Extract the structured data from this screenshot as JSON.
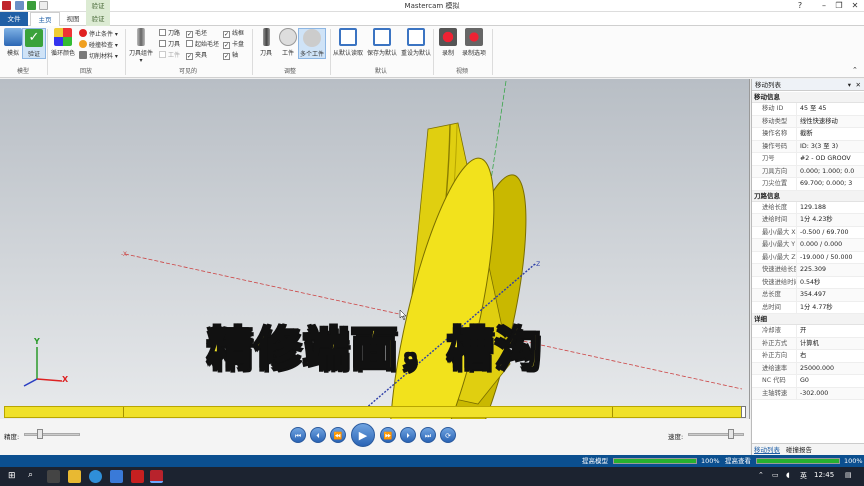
{
  "window": {
    "title": "Mastercam 模拟"
  },
  "tabs": {
    "file": "文件",
    "home": "主页",
    "view": "视图",
    "verify": "验证",
    "context_header": "验证"
  },
  "ribbon": {
    "model_group": {
      "label": "模型",
      "simulate": "模拟",
      "verify": "验证"
    },
    "playback_group": {
      "label": "回放",
      "loop_color": "循环颜色",
      "stop_conditions": "停止条件",
      "collision_check": "碰撞检查",
      "cut_material": "切削材料"
    },
    "visible_group": {
      "label": "可见的",
      "tool_assembly": "刀具组件",
      "toolpath": "刀路",
      "tool": "刀具",
      "workpiece": "工件",
      "blank": "毛坯",
      "initial_blank": "起始毛坯",
      "fixture": "夹具",
      "line_frame": "线框",
      "chuck": "卡盘",
      "axis": "轴",
      "checks": {
        "toolpath": false,
        "tool": false,
        "workpiece": false,
        "blank": true,
        "initial_blank": false,
        "fixture": true,
        "line_frame": true,
        "chuck": true,
        "axis": true
      }
    },
    "adjust_group": {
      "label": "调整",
      "tool": "刀具",
      "workpiece": "工件",
      "multiple": "多个工件"
    },
    "default_group": {
      "label": "默认",
      "read_default": "从默认读取",
      "save_default": "保存为默认",
      "reset_default": "重设为默认"
    },
    "video_group": {
      "label": "视频",
      "record": "录制",
      "record_options": "录制选项"
    }
  },
  "viewport": {
    "subtitle": "精修端面，槽沟",
    "axis_labels": {
      "neg_x": "-X",
      "neg_z": "-Z",
      "y": "Y",
      "x": "X"
    }
  },
  "transport": {
    "precision_label": "精度:",
    "speed_label": "速度:",
    "precision_level": 0.25,
    "speed_level": 0.8
  },
  "panel": {
    "title": "移动列表",
    "sections": [
      {
        "title": "移动信息",
        "rows": [
          {
            "k": "移动 ID",
            "v": "45 至 45"
          },
          {
            "k": "移动类型",
            "v": "线性快速移动"
          },
          {
            "k": "操作名称",
            "v": "截断"
          },
          {
            "k": "操作号码",
            "v": "ID: 3(3 至 3)"
          },
          {
            "k": "刀号",
            "v": "#2 - OD GROOV"
          },
          {
            "k": "刀具方向",
            "v": "0.000; 1.000; 0.0"
          },
          {
            "k": "刀尖位置",
            "v": "69.700; 0.000; 3"
          }
        ]
      },
      {
        "title": "刀路信息",
        "rows": [
          {
            "k": "进给长度",
            "v": "129.188"
          },
          {
            "k": "进给时间",
            "v": "1分 4.23秒"
          },
          {
            "k": "最小/最大 X",
            "v": "-0.500 / 69.700"
          },
          {
            "k": "最小/最大 Y",
            "v": "0.000 / 0.000"
          },
          {
            "k": "最小/最大 Z",
            "v": "-19.000 / 50.000"
          },
          {
            "k": "快速进给长度",
            "v": "225.309"
          },
          {
            "k": "快速进给时间",
            "v": "0.54秒"
          },
          {
            "k": "总长度",
            "v": "354.497"
          },
          {
            "k": "总时间",
            "v": "1分 4.77秒"
          }
        ]
      },
      {
        "title": "详细",
        "rows": [
          {
            "k": "冷却液",
            "v": "开"
          },
          {
            "k": "补正方式",
            "v": "计算机"
          },
          {
            "k": "补正方向",
            "v": "右"
          },
          {
            "k": "进给速率",
            "v": "25000.000"
          },
          {
            "k": "NC 代码",
            "v": "G0"
          },
          {
            "k": "主轴转速",
            "v": "-302.000"
          }
        ]
      }
    ],
    "tabs": [
      "移动列表",
      "碰撞报告"
    ]
  },
  "status": {
    "improve_model": "提高模型",
    "improve_model_pct": "100%",
    "improve_model_level": 1.0,
    "improve_view": "提高查看",
    "improve_view_pct": "100%",
    "improve_view_level": 1.0
  },
  "taskbar": {
    "ime": "英",
    "time": "12:45"
  },
  "colors": {
    "accent": "#1f5fa6",
    "part_yellow": "#f5e626",
    "subtitle_outline": "#111111",
    "progress_green": "#27b12f"
  }
}
